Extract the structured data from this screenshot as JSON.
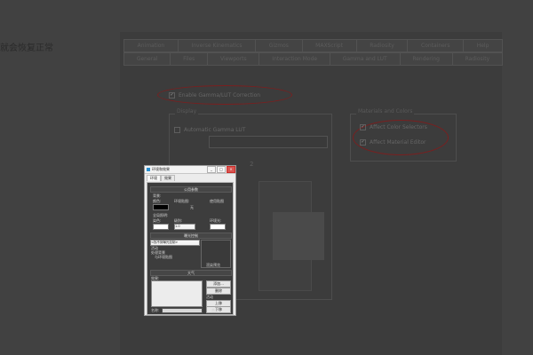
{
  "background": {
    "side_text": "就会恢复正常"
  },
  "main_dialog": {
    "tab_rows": [
      [
        "Animation",
        "Inverse Kinematics",
        "Gizmos",
        "MAXScript",
        "Radiosity",
        "Containers",
        "Help"
      ],
      [
        "General",
        "Files",
        "Viewports",
        "Interaction Mode",
        "Gamma and LUT",
        "Rendering",
        "Radiosity"
      ]
    ],
    "enable_checkbox": "Enable Gamma/LUT Correction",
    "display_group": "Display",
    "display_gamma": "Automatic Gamma LUT",
    "materials_group": "Materials and Colors",
    "affect_color_selectors": "Affect Color Selectors",
    "affect_material_editor": "Affect Material Editor",
    "gamma_value": "2"
  },
  "env_dialog": {
    "title": "环境和效果",
    "tabs": [
      "环境",
      "效果"
    ],
    "sections": {
      "common": "公用参数",
      "exposure": "曝光控制",
      "atmosphere": "大气"
    },
    "labels": {
      "background": "背景:",
      "color": "颜色:",
      "env_map": "环境贴图:",
      "use_map": "使用贴图",
      "none_map": "无",
      "global_lighting": "全局照明:",
      "tint": "染色:",
      "level": "级别:",
      "ambient": "环境光:",
      "level_value": "1.0",
      "exposure_select": "<找不到曝光控制>",
      "active": "活动",
      "process_bg": "处理背景",
      "and_env_map": "与环境贴图",
      "render_preview": "渲染预览",
      "effects": "效果:",
      "add": "添加...",
      "delete": "删除",
      "move_up": "上移",
      "move_down": "下移",
      "merge": "合并",
      "name": "名称:"
    },
    "colors": {
      "background_swatch": "#000000",
      "tint_swatch": "#ffffff",
      "ambient_swatch": "#ffffff"
    },
    "window_buttons": [
      "_",
      "□",
      "×"
    ]
  }
}
